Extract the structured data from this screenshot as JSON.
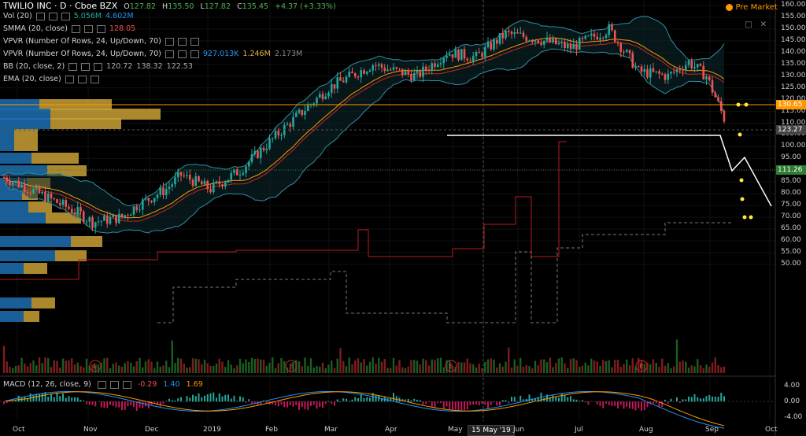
{
  "header": {
    "symbol": "TWILIO INC · D · Cboe BZX",
    "ohlc": [
      {
        "label": "O",
        "value": "127.82"
      },
      {
        "label": "H",
        "value": "135.50"
      },
      {
        "label": "L",
        "value": "127.82"
      },
      {
        "label": "C",
        "value": "135.45"
      }
    ],
    "change": "+4.37 (+3.33%)",
    "pre_market": "Pre Market"
  },
  "indicators": [
    {
      "label": "Vol (20)",
      "values": [
        "5.056M",
        "4.602M"
      ],
      "colors": [
        "#26a69a",
        "#2196f3"
      ]
    },
    {
      "label": "SMMA (20, close)",
      "values": [
        "128.05"
      ],
      "colors": [
        "#ef5350"
      ]
    },
    {
      "label": "VPVR (Number Of Rows, 24, Up/Down, 70)",
      "values": [],
      "colors": []
    },
    {
      "label": "VPVR (Number Of Rows, 24, Up/Down, 70)",
      "values": [
        "927.013K",
        "1.246M",
        "2.173M"
      ],
      "colors": [
        "#2196f3",
        "#e0b040",
        "#888888"
      ]
    },
    {
      "label": "BB (20, close, 2)",
      "values": [
        "120.72",
        "138.32",
        "122.53"
      ],
      "colors": [
        "#aaaaaa",
        "#aaaaaa",
        "#aaaaaa"
      ]
    },
    {
      "label": "EMA (20, close)",
      "values": [],
      "colors": []
    }
  ],
  "macd": {
    "label": "MACD (12, 26, close, 9)",
    "values": [
      "-0.29",
      "1.40",
      "1.69"
    ],
    "colors": [
      "#ef5350",
      "#2196f3",
      "#ff9800"
    ]
  },
  "price_axis": [
    "160.00",
    "155.00",
    "150.00",
    "145.00",
    "140.00",
    "135.00",
    "130.00",
    "125.00",
    "120.00",
    "115.00",
    "110.00",
    "105.00",
    "100.00",
    "95.00",
    "90.00",
    "85.00",
    "80.00",
    "75.00",
    "70.00",
    "65.00",
    "60.00",
    "55.00",
    "50.00"
  ],
  "macd_axis": [
    "4.00",
    "0.00",
    "-4.00"
  ],
  "price_tags": [
    {
      "value": "130.65",
      "color": "#ff9800"
    },
    {
      "value": "123.27",
      "color": "#444444"
    },
    {
      "value": "111.26",
      "color": "#2e7d32"
    }
  ],
  "time_axis": [
    "Oct",
    "Nov",
    "Dec",
    "2019",
    "Feb",
    "Mar",
    "Apr",
    "May",
    "15 May '19",
    "Jun",
    "Jul",
    "Aug",
    "Sep",
    "Oct"
  ],
  "earnings_marker": "E",
  "colors": {
    "up": "#26a69a",
    "down": "#ef5350",
    "bb": "#4fc3f7",
    "ema": "#ff9800",
    "smma": "#ef5350"
  }
}
